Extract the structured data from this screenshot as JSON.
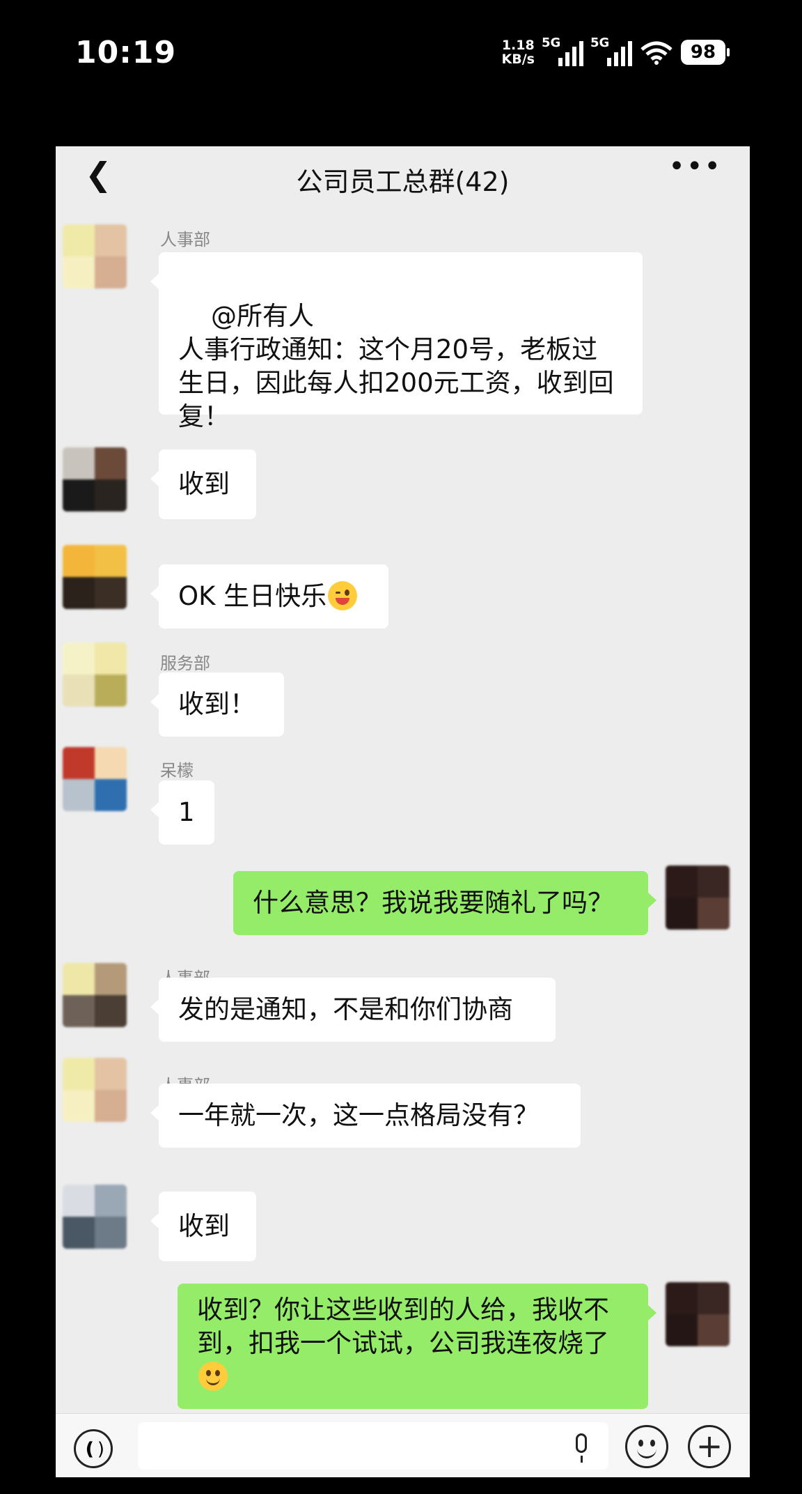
{
  "status_bar": {
    "time": "10:19",
    "speed_value": "1.18",
    "speed_unit": "KB/s",
    "net1": "5G",
    "net2": "5G",
    "battery": "98"
  },
  "header": {
    "title": "公司员工总群(42)"
  },
  "messages": [
    {
      "sender": "人事部",
      "text": "@所有人\n人事行政通知：这个月20号，老板过生日，因此每人扣200元工资，收到回复！"
    },
    {
      "sender": "",
      "text": "收到"
    },
    {
      "sender": "",
      "text": "OK 生日快乐",
      "emoji": "winking-face-tongue"
    },
    {
      "sender": "服务部",
      "text": "收到！"
    },
    {
      "sender": "呆檬",
      "text": "1"
    },
    {
      "sender": "me",
      "text": "什么意思？我说我要随礼了吗？"
    },
    {
      "sender": "人事部",
      "text": "发的是通知，不是和你们协商"
    },
    {
      "sender": "人事部",
      "text": "一年就一次，这一点格局没有？"
    },
    {
      "sender": "",
      "text": "收到"
    },
    {
      "sender": "me",
      "text": "收到？你让这些收到的人给，我收不到，扣我一个试试，公司我连夜烧了",
      "emoji": "smiling-face"
    }
  ],
  "colors": {
    "my_bubble": "#95ec69",
    "other_bubble": "#ffffff",
    "chat_bg": "#ededed"
  }
}
